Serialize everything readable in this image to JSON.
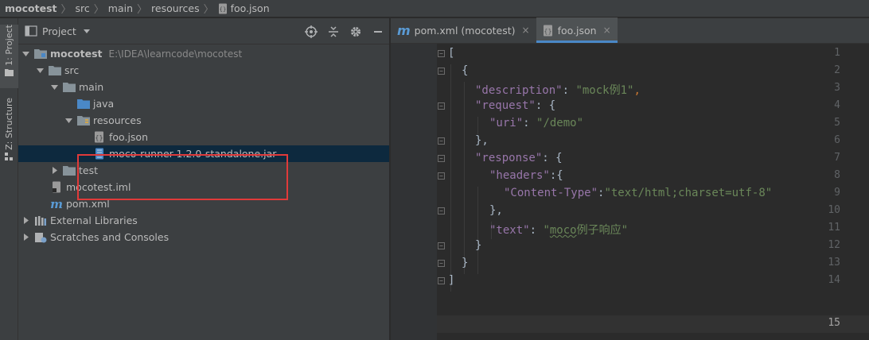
{
  "breadcrumb": [
    "mocotest",
    "src",
    "main",
    "resources",
    "foo.json"
  ],
  "tool_strip": {
    "project_label": "1: Project",
    "structure_label": "Z: Structure"
  },
  "project_panel": {
    "title": "Project",
    "tree": [
      {
        "label": "mocotest",
        "path": "E:\\IDEA\\learncode\\mocotest"
      },
      {
        "label": "src"
      },
      {
        "label": "main"
      },
      {
        "label": "java"
      },
      {
        "label": "resources"
      },
      {
        "label": "foo.json"
      },
      {
        "label": "moco-runner-1.2.0-standalone.jar"
      },
      {
        "label": "test"
      },
      {
        "label": "mocotest.iml"
      },
      {
        "label": "pom.xml"
      },
      {
        "label": "External Libraries"
      },
      {
        "label": "Scratches and Consoles"
      }
    ]
  },
  "editor": {
    "tabs": [
      {
        "label": "pom.xml (mocotest)",
        "close": "×"
      },
      {
        "label": "foo.json",
        "close": "×"
      }
    ],
    "line_numbers": [
      "1",
      "2",
      "3",
      "4",
      "5",
      "6",
      "7",
      "8",
      "9",
      "10",
      "11",
      "12",
      "13",
      "14",
      "15"
    ],
    "code": {
      "l1": "[",
      "l2": "{",
      "description_key": "\"description\"",
      "description_val": "\"mock例1\"",
      "request_key": "\"request\"",
      "uri_key": "\"uri\"",
      "uri_val": "\"/demo\"",
      "l6": "},",
      "response_key": "\"response\"",
      "headers_key": "\"headers\"",
      "ct_key": "\"Content-Type\"",
      "ct_val": "\"text/html;charset=utf-8\"",
      "l10": "},",
      "text_key": "\"text\"",
      "text_val_q": "\"",
      "text_val_moco": "moco",
      "text_val_rest": "例子响应\"",
      "l12": "}",
      "l13": "}",
      "l14": "]"
    }
  },
  "colors": {
    "background": "#2b2b2b",
    "panel": "#3c3f41",
    "selection": "#0d293e",
    "highlight_box": "#e03a3a",
    "json_key": "#9876aa",
    "json_string": "#6a8759"
  }
}
